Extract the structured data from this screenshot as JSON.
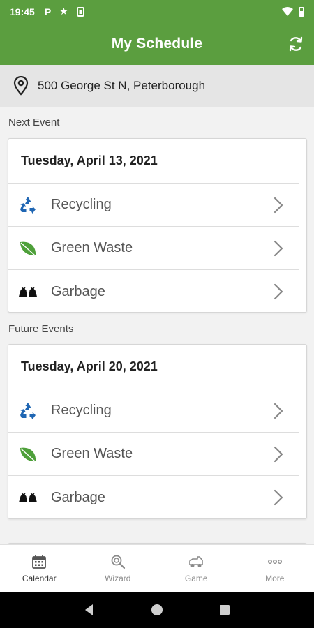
{
  "status_bar": {
    "time": "19:45",
    "icons": [
      "p-icon",
      "star-icon",
      "sim-icon"
    ],
    "right_icons": [
      "wifi-icon",
      "battery-icon"
    ]
  },
  "header": {
    "title": "My Schedule",
    "refresh_icon": "refresh-icon",
    "background_color": "#5b9e3f"
  },
  "address": {
    "icon": "location-pin-icon",
    "text": "500 George St N, Peterborough"
  },
  "next_event": {
    "section_label": "Next Event",
    "date": "Tuesday, April 13, 2021",
    "items": [
      {
        "label": "Recycling",
        "icon": "recycling-icon"
      },
      {
        "label": "Green Waste",
        "icon": "leaf-icon"
      },
      {
        "label": "Garbage",
        "icon": "garbage-bags-icon"
      }
    ]
  },
  "future_events": {
    "section_label": "Future Events",
    "date": "Tuesday, April 20, 2021",
    "items": [
      {
        "label": "Recycling",
        "icon": "recycling-icon"
      },
      {
        "label": "Green Waste",
        "icon": "leaf-icon"
      },
      {
        "label": "Garbage",
        "icon": "garbage-bags-icon"
      }
    ]
  },
  "bottom_nav": [
    {
      "label": "Calendar",
      "icon": "calendar-icon",
      "active": true
    },
    {
      "label": "Wizard",
      "icon": "magnifier-icon",
      "active": false
    },
    {
      "label": "Game",
      "icon": "truck-icon",
      "active": false
    },
    {
      "label": "More",
      "icon": "more-dots-icon",
      "active": false
    }
  ],
  "colors": {
    "brand_green": "#5b9e3f",
    "recycling_blue": "#1f66b3",
    "leaf_green": "#4ea03a"
  }
}
